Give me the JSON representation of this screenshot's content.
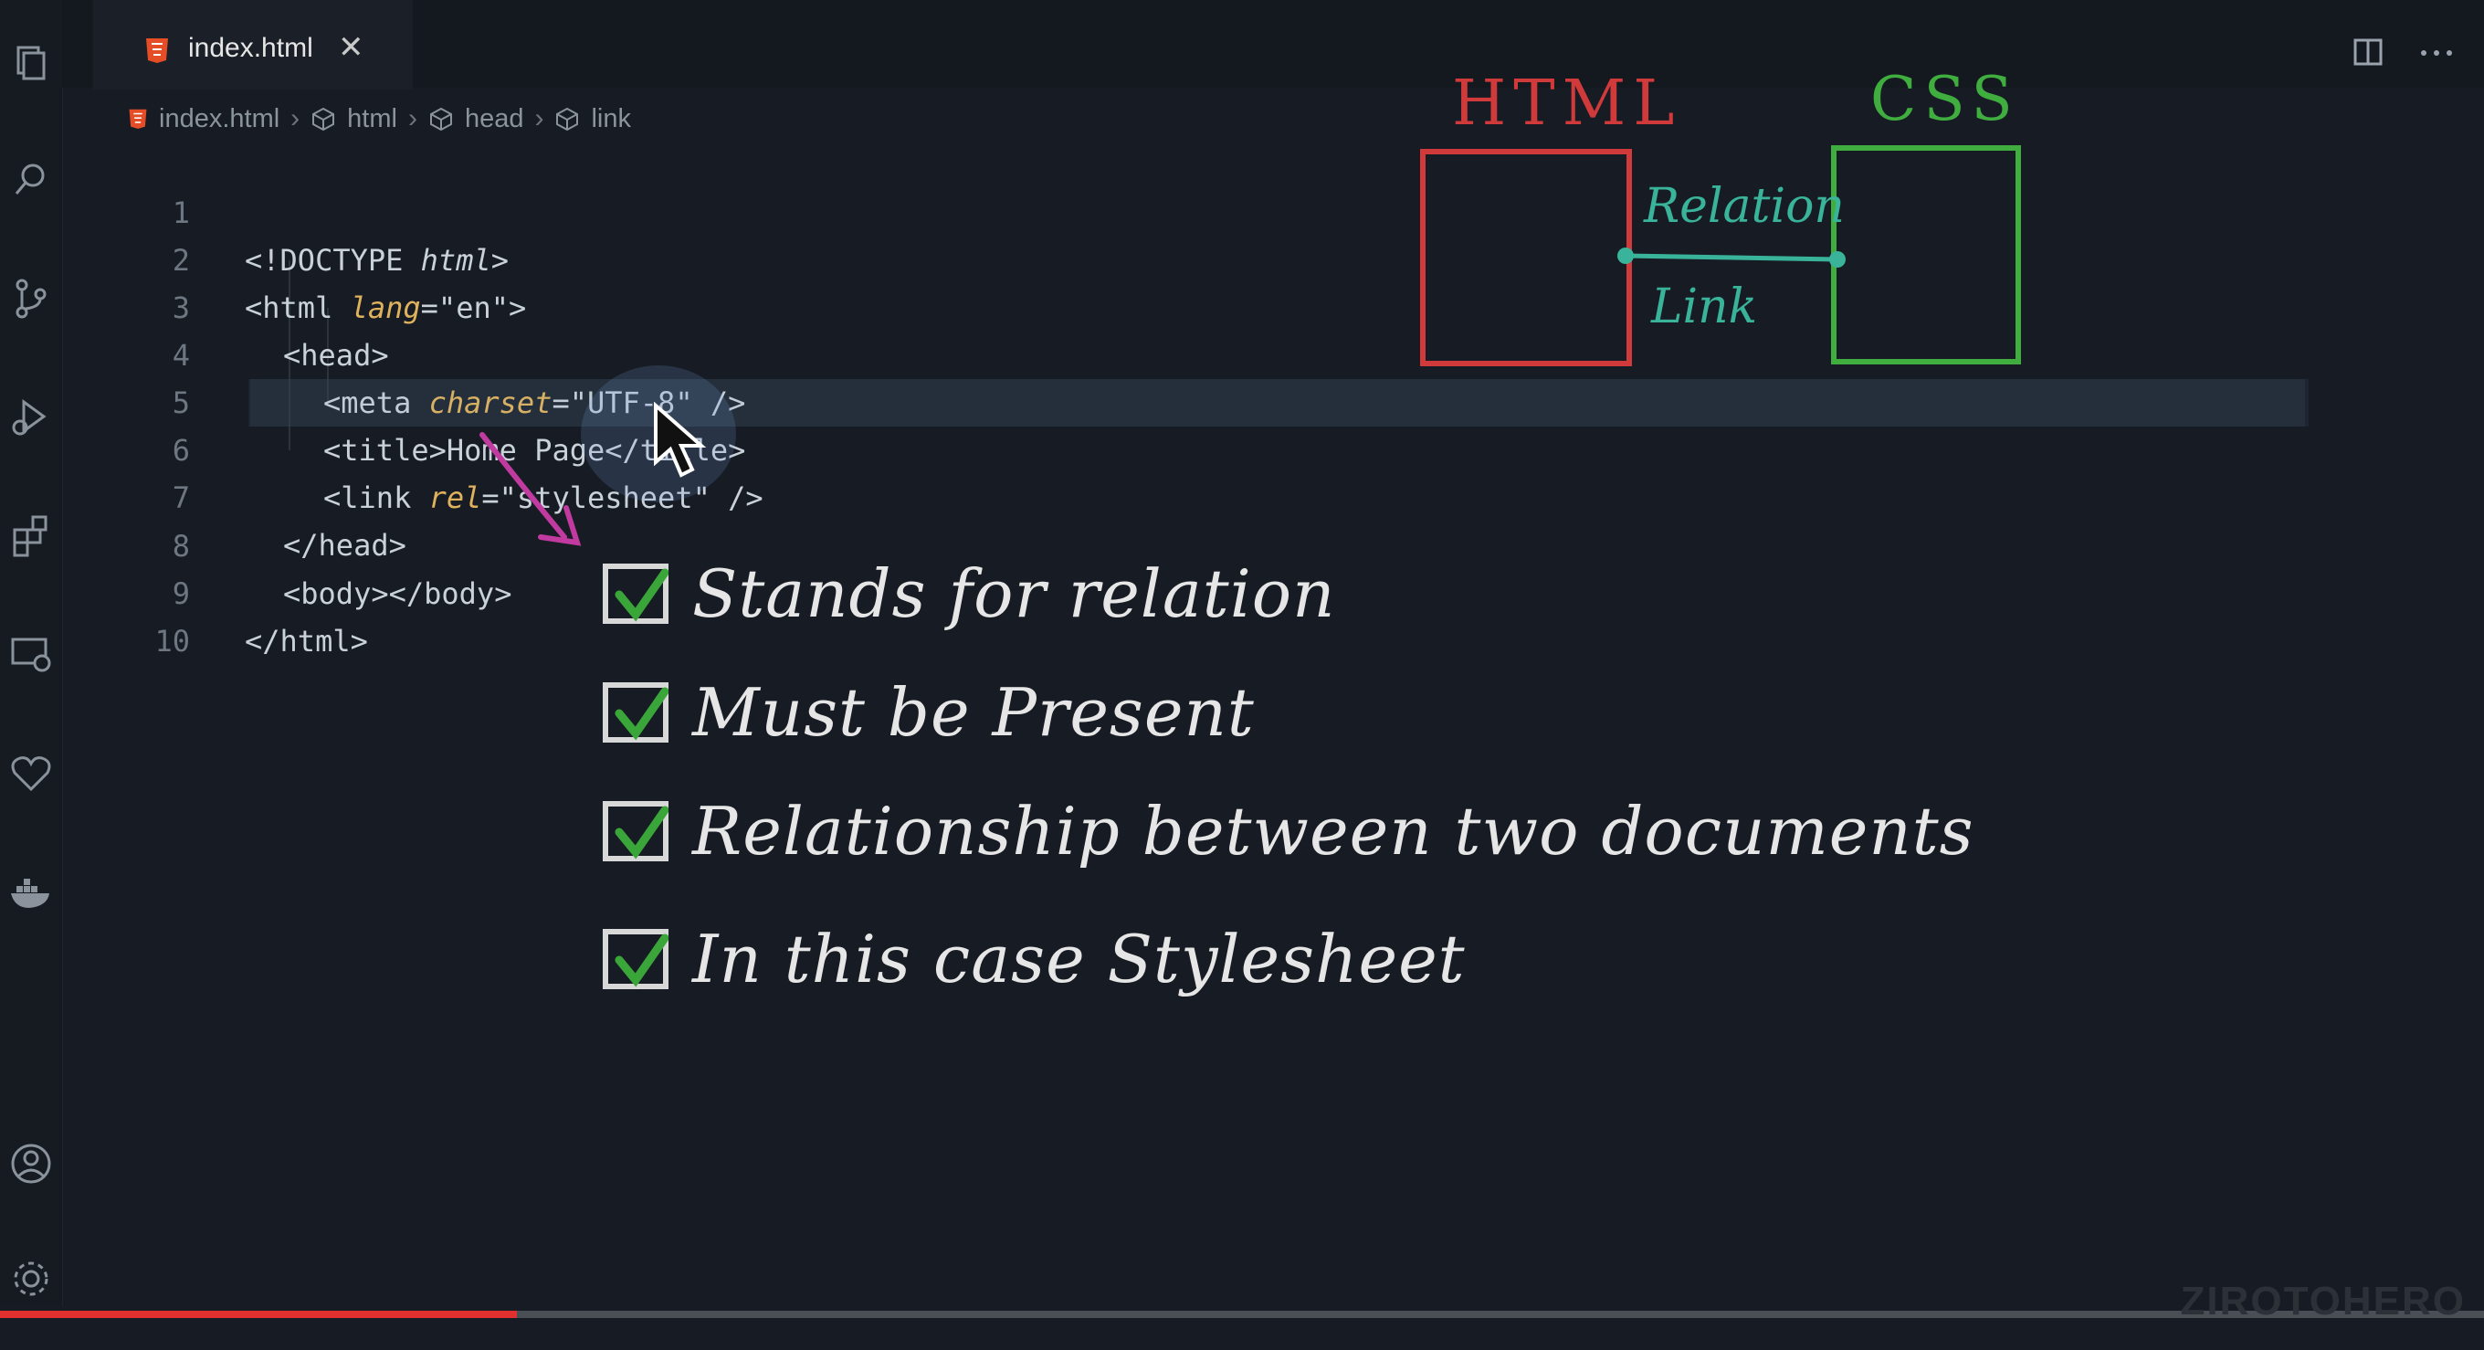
{
  "tab": {
    "filename": "index.html",
    "close": "✕"
  },
  "breadcrumbs": [
    {
      "label": "index.html",
      "icon": "html5-icon"
    },
    {
      "label": "html",
      "icon": "cube-icon"
    },
    {
      "label": "head",
      "icon": "cube-icon"
    },
    {
      "label": "link",
      "icon": "cube-icon"
    }
  ],
  "editor": {
    "lines": [
      {
        "num": "1"
      },
      {
        "num": "2"
      },
      {
        "num": "3"
      },
      {
        "num": "4"
      },
      {
        "num": "5"
      },
      {
        "num": "6"
      },
      {
        "num": "7"
      },
      {
        "num": "8"
      },
      {
        "num": "9"
      },
      {
        "num": "10"
      }
    ],
    "code": {
      "l1_a": "<!DOCTYPE ",
      "l1_b": "html",
      "l1_c": ">",
      "l2_a": "<html ",
      "l2_b": "lang",
      "l2_c": "=\"en\">",
      "l3": "<head>",
      "l4_a": "<meta ",
      "l4_b": "charset",
      "l4_c": "=\"UTF-8\" />",
      "l5": "<title>Home Page</title>",
      "l6_a": "<link ",
      "l6_b": "rel",
      "l6_c": "=\"stylesheet\" />",
      "l7": "</head>",
      "l8": "<body></body>",
      "l9": "</html>"
    }
  },
  "diagram": {
    "left_label": "HTML",
    "right_label": "CSS",
    "link_top": "Relation",
    "link_bottom": "Link",
    "left_color": "#d03a3a",
    "right_color": "#3fae3f",
    "link_color": "#39b49a"
  },
  "checklist": [
    "Stands for relation",
    "Must be Present",
    "Relationship between two documents",
    "In this case Stylesheet"
  ],
  "video": {
    "progress_percent": 20.8,
    "watermark": "ZIROTOHERO"
  },
  "colors": {
    "arrow": "#c13aa0",
    "check": "#3aa63a"
  }
}
